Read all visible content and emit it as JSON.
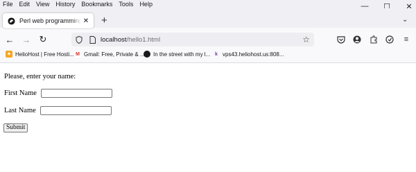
{
  "menu": [
    "File",
    "Edit",
    "View",
    "History",
    "Bookmarks",
    "Tools",
    "Help"
  ],
  "window_controls": {
    "minimize": "—",
    "maximize": "☐",
    "close": "✕"
  },
  "tab": {
    "title": "Perl web programming (HTML i"
  },
  "url": {
    "host": "localhost",
    "path": "/hello1.html"
  },
  "bookmarks": [
    {
      "label": "HelioHost | Free Hosti...",
      "icon": "heliohost-icon"
    },
    {
      "label": "Gmail: Free, Private & ...",
      "icon": "gmail-icon"
    },
    {
      "label": "In the street with my l...",
      "icon": "perl-camel-icon"
    },
    {
      "label": "vps43.heliohost.us:808...",
      "icon": "vps-icon"
    }
  ],
  "page": {
    "prompt": "Please, enter your name:",
    "first_name_label": "First Name",
    "first_name_value": "",
    "last_name_label": "Last Name",
    "last_name_value": "",
    "submit_label": "Submit"
  }
}
